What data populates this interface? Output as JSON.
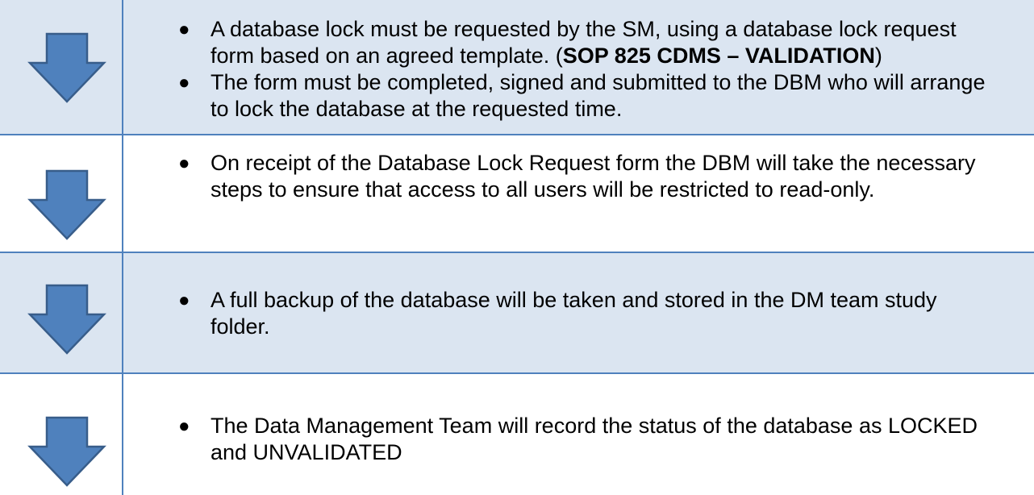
{
  "steps": [
    {
      "bullets": [
        {
          "parts": [
            {
              "text": "A database lock must be requested by the SM, using a database lock request form based on an agreed template. (",
              "bold": false
            },
            {
              "text": "SOP 825 CDMS – VALIDATION",
              "bold": true
            },
            {
              "text": ")",
              "bold": false
            }
          ]
        },
        {
          "parts": [
            {
              "text": "The form must be completed, signed and submitted to the DBM who will arrange to lock the database at the requested time.",
              "bold": false
            }
          ]
        }
      ]
    },
    {
      "bullets": [
        {
          "parts": [
            {
              "text": "On receipt of the Database Lock Request form the DBM will take the necessary steps to ensure that access to all users will be restricted to read-only.",
              "bold": false
            }
          ]
        }
      ]
    },
    {
      "bullets": [
        {
          "parts": [
            {
              "text": "A full backup of the database will be taken and stored in the DM team study folder.",
              "bold": false
            }
          ]
        }
      ]
    },
    {
      "bullets": [
        {
          "parts": [
            {
              "text": "The Data Management Team will record the status of the database as LOCKED and UNVALIDATED",
              "bold": false
            }
          ]
        }
      ]
    }
  ],
  "colors": {
    "row_shade": "#dbe5f1",
    "arrow_fill": "#4f81bd",
    "arrow_stroke": "#385d8a",
    "rule": "#4f81bd"
  },
  "icons": {
    "step_arrow": "arrow-down-icon",
    "bullet": "bullet-dot-icon"
  }
}
